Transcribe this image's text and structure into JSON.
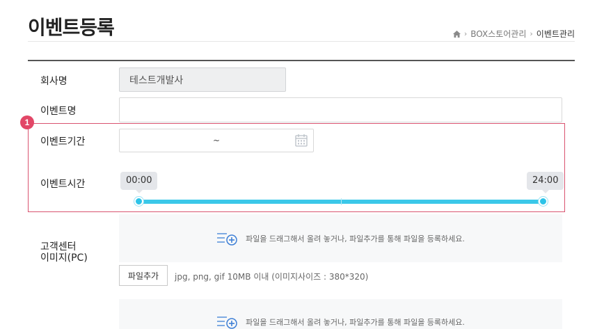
{
  "header": {
    "title": "이벤트등록",
    "breadcrumb": [
      "BOX스토어관리",
      "이벤트관리"
    ]
  },
  "form": {
    "company_label": "회사명",
    "company_value": "테스트개발사",
    "event_name_label": "이벤트명",
    "event_name_value": "",
    "event_period_label": "이벤트기간",
    "event_period_separator": "~",
    "event_time_label": "이벤트시간",
    "time_start": "00:00",
    "time_end": "24:00",
    "time_range_hours": [
      0,
      24
    ],
    "image_pc_label_line1": "고객센터",
    "image_pc_label_line2": "이미지(PC)",
    "dropzone_text": "파일을 드래그해서 올려 놓거나, 파일추가를 통해 파일을 등록하세요.",
    "file_add_button": "파일추가",
    "file_hint": "jpg, png, gif 10MB 이내 (이미지사이즈 : 380*320)"
  },
  "annotation": {
    "marker_number": "1",
    "color": "#e24767"
  },
  "colors": {
    "slider": "#3bc8e9",
    "highlight_border": "#d9536f"
  },
  "icons": [
    "home-icon",
    "chevron-right-icon",
    "calendar-icon",
    "add-file-icon"
  ]
}
